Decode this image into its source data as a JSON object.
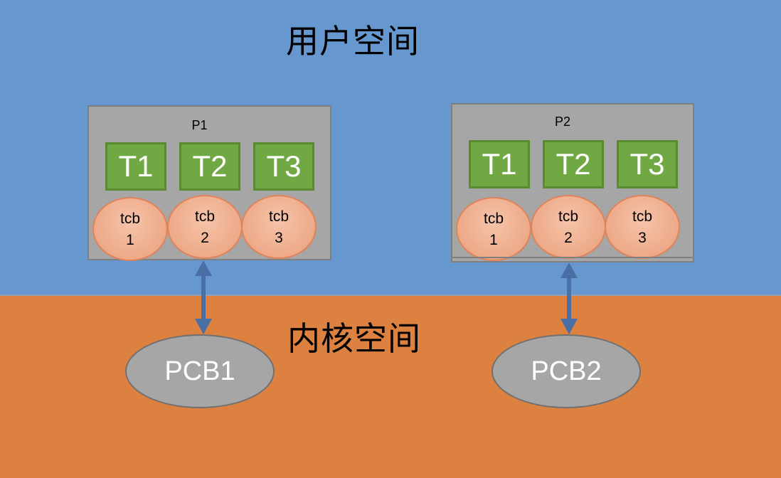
{
  "regions": {
    "user_space": "用户空间",
    "kernel_space": "内核空间"
  },
  "processes": [
    {
      "label": "P1",
      "threads": [
        "T1",
        "T2",
        "T3"
      ],
      "tcbs": [
        {
          "name": "tcb",
          "num": "1"
        },
        {
          "name": "tcb",
          "num": "2"
        },
        {
          "name": "tcb",
          "num": "3"
        }
      ],
      "pcb": "PCB1"
    },
    {
      "label": "P2",
      "threads": [
        "T1",
        "T2",
        "T3"
      ],
      "tcbs": [
        {
          "name": "tcb",
          "num": "1"
        },
        {
          "name": "tcb",
          "num": "2"
        },
        {
          "name": "tcb",
          "num": "3"
        }
      ],
      "pcb": "PCB2"
    }
  ],
  "colors": {
    "user_space": "#6797CF",
    "kernel_space": "#DD8141",
    "thread": "#70A844",
    "tcb": "#EDAA88",
    "pcb": "#A6A6A6",
    "arrow": "#4A6FA5"
  }
}
